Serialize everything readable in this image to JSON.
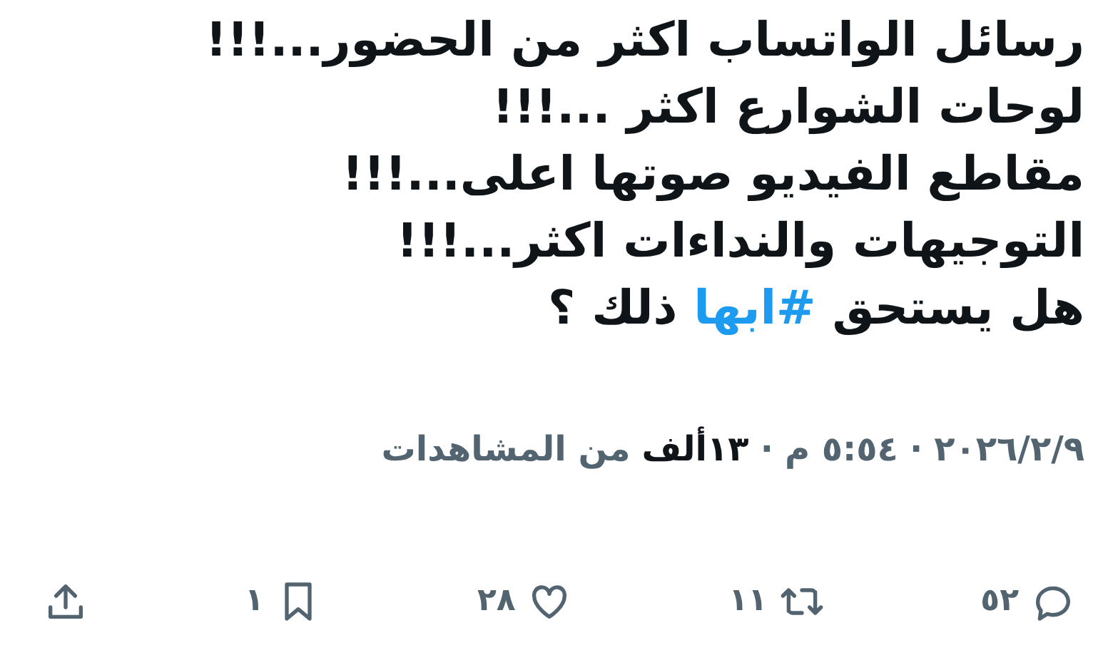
{
  "tweet_lines": [
    [
      {
        "kind": "text",
        "text": "رسائل الواتساب اكثر من الحضور...!!!"
      }
    ],
    [
      {
        "kind": "text",
        "text": "لوحات الشوارع اكثر ...!!!"
      }
    ],
    [
      {
        "kind": "text",
        "text": "مقاطع الفيديو صوتها اعلى...!!!"
      }
    ],
    [
      {
        "kind": "text",
        "text": "التوجيهات والنداءات اكثر...!!!"
      }
    ],
    [
      {
        "kind": "text",
        "text": "هل يستحق "
      },
      {
        "kind": "hashtag",
        "text": "#ابها"
      },
      {
        "kind": "text",
        "text": " ذلك ؟"
      }
    ]
  ],
  "meta": [
    {
      "kind": "plain",
      "text": "٢٠٢٦/٢/٩"
    },
    {
      "kind": "sep",
      "text": "·"
    },
    {
      "kind": "plain",
      "text": "٥:٥٤ م"
    },
    {
      "kind": "sep",
      "text": "·"
    },
    {
      "kind": "strong",
      "text": "١٣ألف"
    },
    {
      "kind": "plain",
      "text": "من المشاهدات"
    }
  ],
  "actions": [
    {
      "kind": "reply",
      "count": "٥٢"
    },
    {
      "kind": "repost",
      "count": "١١"
    },
    {
      "kind": "like",
      "count": "٢٨"
    },
    {
      "kind": "bookmark",
      "count": "١"
    },
    {
      "kind": "share"
    }
  ]
}
